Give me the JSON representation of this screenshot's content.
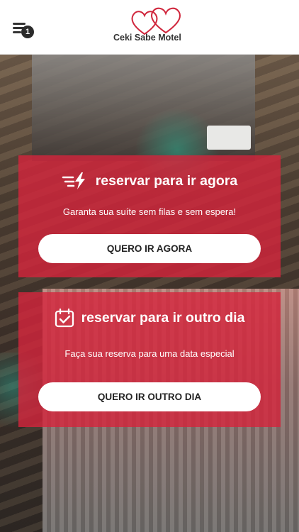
{
  "header": {
    "menu_badge": "1",
    "logo_text": "Ceki Sabe Motel"
  },
  "cards": [
    {
      "title": "reservar para ir agora",
      "subtitle": "Garanta sua suíte sem filas e sem espera!",
      "button": "QUERO IR AGORA",
      "icon": "fast-bolt-icon"
    },
    {
      "title": "reservar para ir outro dia",
      "subtitle": "Faça sua reserva para uma data especial",
      "button": "QUERO IR OUTRO DIA",
      "icon": "calendar-check-icon"
    }
  ],
  "colors": {
    "accent": "#d6243c",
    "logo_hearts": "#d0263c"
  }
}
